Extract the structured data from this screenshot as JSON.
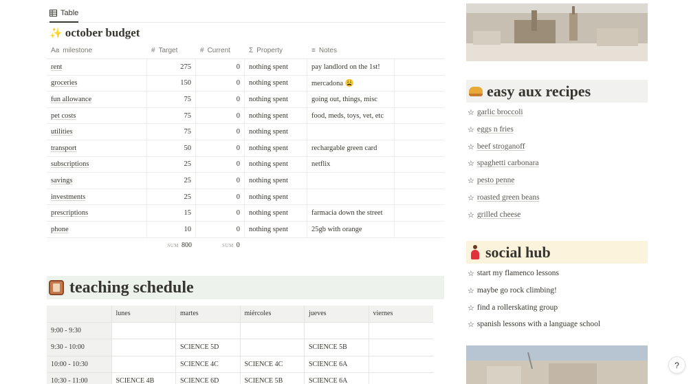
{
  "view_tab": {
    "label": "Table",
    "icon": "table-icon"
  },
  "budget": {
    "title": "october budget",
    "title_icon": "sparkles-icon",
    "columns": [
      {
        "label": "milestone",
        "icon": "Aa"
      },
      {
        "label": "Target",
        "icon": "#"
      },
      {
        "label": "Current",
        "icon": "#"
      },
      {
        "label": "Property",
        "icon": "Σ"
      },
      {
        "label": "Notes",
        "icon": "≡"
      }
    ],
    "rows": [
      {
        "milestone": "rent",
        "target": "275",
        "current": "0",
        "property": "nothing spent",
        "notes": "pay landlord on the 1st!"
      },
      {
        "milestone": "groceries",
        "target": "150",
        "current": "0",
        "property": "nothing spent",
        "notes": "mercadona 😩"
      },
      {
        "milestone": "fun allowance",
        "target": "75",
        "current": "0",
        "property": "nothing spent",
        "notes": "going out, things, misc"
      },
      {
        "milestone": "pet costs",
        "target": "75",
        "current": "0",
        "property": "nothing spent",
        "notes": "food, meds, toys, vet, etc"
      },
      {
        "milestone": "utilities",
        "target": "75",
        "current": "0",
        "property": "nothing spent",
        "notes": ""
      },
      {
        "milestone": "transport",
        "target": "50",
        "current": "0",
        "property": "nothing spent",
        "notes": "rechargable green card"
      },
      {
        "milestone": "subscriptions",
        "target": "25",
        "current": "0",
        "property": "nothing spent",
        "notes": "netflix"
      },
      {
        "milestone": "savings",
        "target": "25",
        "current": "0",
        "property": "nothing spent",
        "notes": ""
      },
      {
        "milestone": "investments",
        "target": "25",
        "current": "0",
        "property": "nothing spent",
        "notes": ""
      },
      {
        "milestone": "prescriptions",
        "target": "15",
        "current": "0",
        "property": "nothing spent",
        "notes": "farmacia down the street"
      },
      {
        "milestone": "phone",
        "target": "10",
        "current": "0",
        "property": "nothing spent",
        "notes": "25gb with orange"
      }
    ],
    "sum_label": "SUM",
    "sum_target": "800",
    "sum_current": "0"
  },
  "teaching": {
    "title": "teaching schedule",
    "title_icon": "book-icon",
    "days": [
      "lunes",
      "martes",
      "miércoles",
      "jueves",
      "viernes"
    ],
    "rows": [
      {
        "time": "9:00 - 9:30",
        "cells": [
          "",
          "",
          "",
          "",
          ""
        ]
      },
      {
        "time": "9:30 - 10:00",
        "cells": [
          "",
          "SCIENCE 5D",
          "",
          "SCIENCE 5B",
          ""
        ]
      },
      {
        "time": "10:00 - 10:30",
        "cells": [
          "",
          "SCIENCE 4C",
          "SCIENCE 4C",
          "SCIENCE 6A",
          ""
        ]
      },
      {
        "time": "10:30 - 11:00",
        "cells": [
          "SCIENCE 4B",
          "SCIENCE 6D",
          "SCIENCE 5B",
          "SCIENCE 6A",
          ""
        ]
      }
    ]
  },
  "recipes": {
    "title": "easy aux recipes",
    "title_icon": "sandwich-icon",
    "items": [
      "garlic broccoli",
      "eggs n fries",
      "beef stroganoff",
      "spaghetti carbonara",
      "pesto penne",
      "roasted green beans",
      "grilled cheese"
    ]
  },
  "social": {
    "title": "social hub",
    "title_icon": "dancer-icon",
    "items": [
      "start my flamenco lessons",
      "maybe go rock climbing!",
      "find a rollerskating group",
      "spanish lessons with a language school"
    ]
  },
  "help": {
    "label": "?"
  }
}
